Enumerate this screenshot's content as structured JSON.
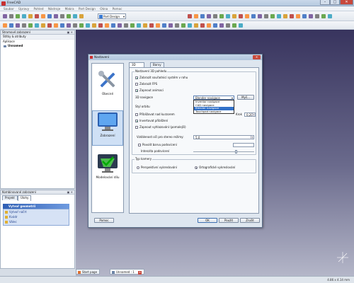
{
  "window": {
    "title": "FreeCAD",
    "min": "–",
    "max": "□",
    "close": "✕"
  },
  "menubar": [
    "Soubor",
    "Úpravy",
    "Pohled",
    "Nástroje",
    "Makra",
    "Part Design",
    "Okna",
    "Pomoc"
  ],
  "workbench": {
    "selected": "Part Design"
  },
  "tree_panel": {
    "title": "Stromové zobrazení",
    "header": "Štítky & atributy",
    "section": "Aplikace",
    "document": "Unnamed"
  },
  "combi_panel": {
    "title": "Kombinované zobrazení",
    "tabs": [
      "Projekt",
      "Úlohy"
    ],
    "task_title": "Vytvoř geometrii",
    "tasks": [
      "Vytvoř náčrt",
      "Kvádr",
      "Válec"
    ]
  },
  "doc_tabs": [
    "Start page",
    "Unnamed : 1"
  ],
  "status": {
    "dimensions": "4.86 x 4.14 mm"
  },
  "dialog": {
    "title": "Nastavení",
    "close": "✕",
    "pages": [
      "Obecné",
      "Zobrazení",
      "Modelování dílu"
    ],
    "tabs": [
      "3D pohled",
      "Barvy"
    ],
    "general_group": "Nastavení 3D pohledu",
    "checks": [
      {
        "label": "Zobrazit souřadnicí systém v rohu",
        "on": true
      },
      {
        "label": "Zobrazit FPS",
        "on": false
      },
      {
        "label": "Zapnout animaci",
        "on": true
      }
    ],
    "nav_label": "3D navigace",
    "nav_value": "Blender navigace",
    "nav_more": "Myš...",
    "nav_options": [
      "Inventor navigace",
      "CAD navigace",
      "Blender navigace",
      "Touchpad navigace"
    ],
    "nav_highlight_index": 2,
    "orbit_label": "Styl orbitu",
    "zoom_checks": [
      {
        "label": "Přibližovat nad kurzorem",
        "on": false
      },
      {
        "label": "Invertovat přiblížení",
        "on": true
      },
      {
        "label": "Zapnout vyhlazování (pomalejší)",
        "on": false
      }
    ],
    "zoom_step_label": "Krok",
    "zoom_step_value": "0,20",
    "eye_distance_label": "Vzdálenost očí pro stereo režimy:",
    "eye_distance_value": "5,0",
    "backlight_label": "Povolit barvu podsvícení",
    "backlight_on": false,
    "intensity_label": "Intenzita podsvícení",
    "intensity_fraction": 0.7,
    "camera_group": "Typ kamery",
    "camera_options": [
      {
        "label": "Perspektivní vykreslování",
        "on": false
      },
      {
        "label": "Ortografické vykreslování",
        "on": true
      }
    ],
    "buttons": {
      "help": "Pomoc",
      "ok": "OK",
      "apply": "Použít",
      "cancel": "Zrušit"
    }
  },
  "colors": {
    "accent": "#3271c8",
    "view_top": "#38345e",
    "view_bottom": "#b4b6c8"
  }
}
